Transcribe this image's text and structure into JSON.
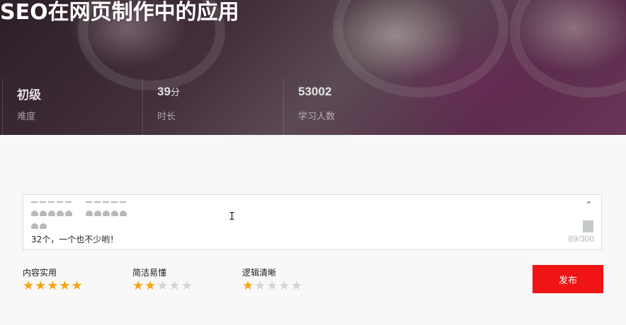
{
  "course": {
    "title": "SEO在网页制作中的应用",
    "stats": [
      {
        "value": "初级",
        "unit": "",
        "label": "难度"
      },
      {
        "value": "39",
        "unit": "分",
        "label": "时长"
      },
      {
        "value": "53002",
        "unit": "",
        "label": "学习人数"
      }
    ]
  },
  "editor": {
    "text": "32个，一个也不少哟！",
    "counter": "89/300",
    "scroll_up_icon": "chevron-up-icon",
    "scroll_down_icon": "chevron-down-icon"
  },
  "ratings": [
    {
      "label": "内容实用",
      "score": 5,
      "max": 5
    },
    {
      "label": "简洁易懂",
      "score": 2,
      "max": 5
    },
    {
      "label": "逻辑清晰",
      "score": 1,
      "max": 5
    }
  ],
  "actions": {
    "publish_label": "发布"
  },
  "colors": {
    "accent": "#f01414",
    "star_on": "#f7a414",
    "star_off": "#d1d6da"
  }
}
